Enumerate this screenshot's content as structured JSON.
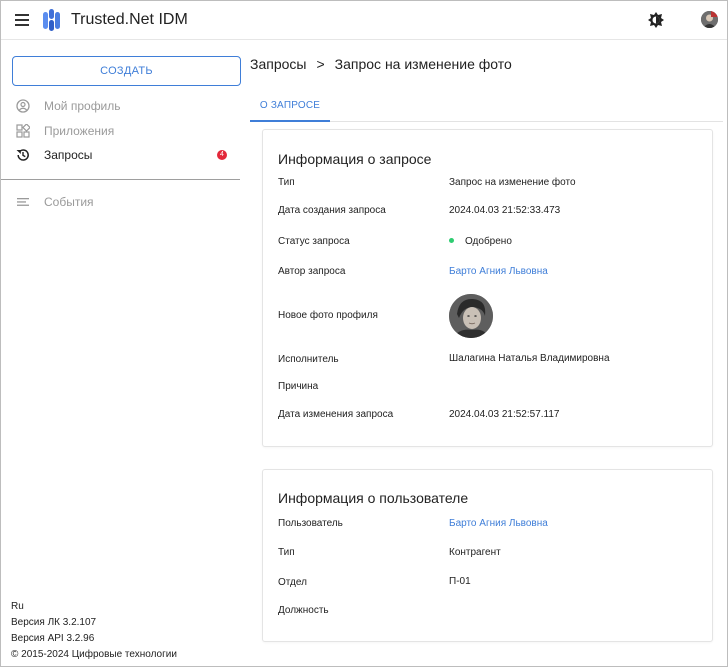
{
  "app": {
    "title": "Trusted.Net IDM"
  },
  "header": {
    "theme_icons": [
      "brightness-icon",
      "moon-icon"
    ],
    "avatar": "user-avatar"
  },
  "sidebar": {
    "create_label": "СОЗДАТЬ",
    "items": [
      {
        "label": "Мой профиль",
        "icon": "user-circle-icon",
        "disabled": true
      },
      {
        "label": "Приложения",
        "icon": "apps-grid-icon",
        "disabled": true
      },
      {
        "label": "Запросы",
        "icon": "history-icon",
        "disabled": false,
        "badge": "4"
      },
      {
        "label": "События",
        "icon": "list-icon",
        "disabled": true
      }
    ],
    "footer": {
      "lang": "Ru",
      "version_lk": "Версия ЛК 3.2.107",
      "version_api": "Версия API 3.2.96",
      "copyright": "© 2015-2024 Цифровые технологии"
    }
  },
  "breadcrumb": {
    "parent": "Запросы",
    "separator": ">",
    "current": "Запрос на изменение фото"
  },
  "tabs": [
    {
      "label": "О ЗАПРОСЕ",
      "active": true
    }
  ],
  "request_info": {
    "title": "Информация о запросе",
    "rows": [
      {
        "label": "Тип",
        "value": "Запрос на изменение фото"
      },
      {
        "label": "Дата создания запроса",
        "value": "2024.04.03 21:52:33.473"
      },
      {
        "label": "Статус запроса",
        "value": "Одобрено"
      },
      {
        "label": "Автор запроса",
        "value": "Барто Агния Львовна"
      },
      {
        "label": "Новое фото профиля",
        "value": ""
      },
      {
        "label": "Исполнитель",
        "value": "Шалагина Наталья Владимировна"
      },
      {
        "label": "Причина",
        "value": ""
      },
      {
        "label": "Дата изменения запроса",
        "value": "2024.04.03 21:52:57.117"
      }
    ]
  },
  "user_info": {
    "title": "Информация о пользователе",
    "rows": [
      {
        "label": "Пользователь",
        "value": "Барто Агния Львовна"
      },
      {
        "label": "Тип",
        "value": "Контрагент"
      },
      {
        "label": "Отдел",
        "value": "П-01"
      },
      {
        "label": "Должность",
        "value": ""
      }
    ]
  },
  "colors": {
    "accent": "#3f7ed8",
    "badge": "#e3283a",
    "status_ok": "#2ecc71"
  }
}
